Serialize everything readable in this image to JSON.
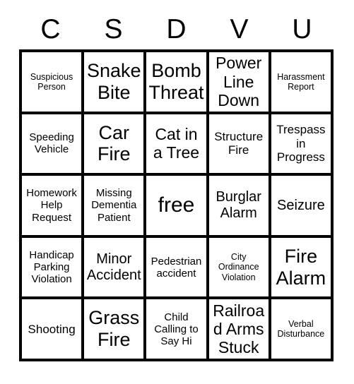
{
  "card": {
    "title_letters": [
      "C",
      "S",
      "D",
      "V",
      "U"
    ],
    "rows": [
      [
        {
          "label": "Suspicious Person",
          "size": "xs"
        },
        {
          "label": "Snake Bite",
          "size": "xxl"
        },
        {
          "label": "Bomb Threat",
          "size": "xxl"
        },
        {
          "label": "Power Line Down",
          "size": "xl"
        },
        {
          "label": "Harassment Report",
          "size": "xs"
        }
      ],
      [
        {
          "label": "Speeding Vehicle",
          "size": "sm"
        },
        {
          "label": "Car Fire",
          "size": "xxl"
        },
        {
          "label": "Cat in a Tree",
          "size": "xl"
        },
        {
          "label": "Structure Fire",
          "size": "md"
        },
        {
          "label": "Trespass in Progress",
          "size": "md"
        }
      ],
      [
        {
          "label": "Homework Help Request",
          "size": "sm"
        },
        {
          "label": "Missing Dementia Patient",
          "size": "sm"
        },
        {
          "label": "free",
          "size": "free"
        },
        {
          "label": "Burglar Alarm",
          "size": "lg"
        },
        {
          "label": "Seizure",
          "size": "lg"
        }
      ],
      [
        {
          "label": "Handicap Parking Violation",
          "size": "sm"
        },
        {
          "label": "Minor Accident",
          "size": "lg"
        },
        {
          "label": "Pedestrian accident",
          "size": "sm"
        },
        {
          "label": "City Ordinance Violation",
          "size": "xs"
        },
        {
          "label": "Fire Alarm",
          "size": "xxl"
        }
      ],
      [
        {
          "label": "Shooting",
          "size": "md"
        },
        {
          "label": "Grass Fire",
          "size": "xxl"
        },
        {
          "label": "Child Calling to Say Hi",
          "size": "sm"
        },
        {
          "label": "Railroad Arms Stuck",
          "size": "xl"
        },
        {
          "label": "Verbal Disturbance",
          "size": "xs"
        }
      ]
    ]
  },
  "colors": {
    "background": "#ffffff",
    "border": "#000000",
    "text": "#000000"
  }
}
